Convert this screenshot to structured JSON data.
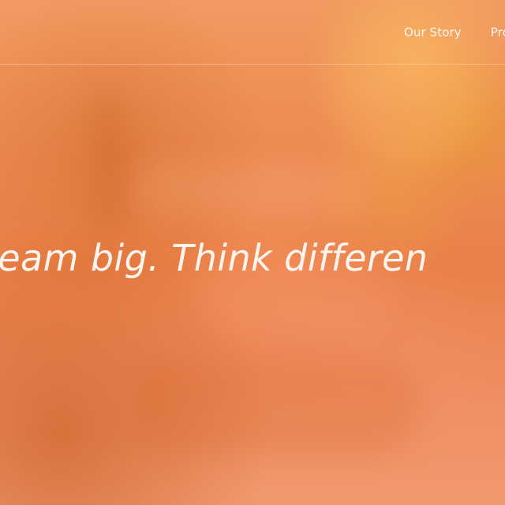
{
  "nav": {
    "items": [
      {
        "label": "Our Story"
      },
      {
        "label": "Pro"
      }
    ]
  },
  "hero": {
    "headline": "ream big. Think differen"
  },
  "colors": {
    "background": "#ec8a52",
    "text": "#fff4ee"
  }
}
